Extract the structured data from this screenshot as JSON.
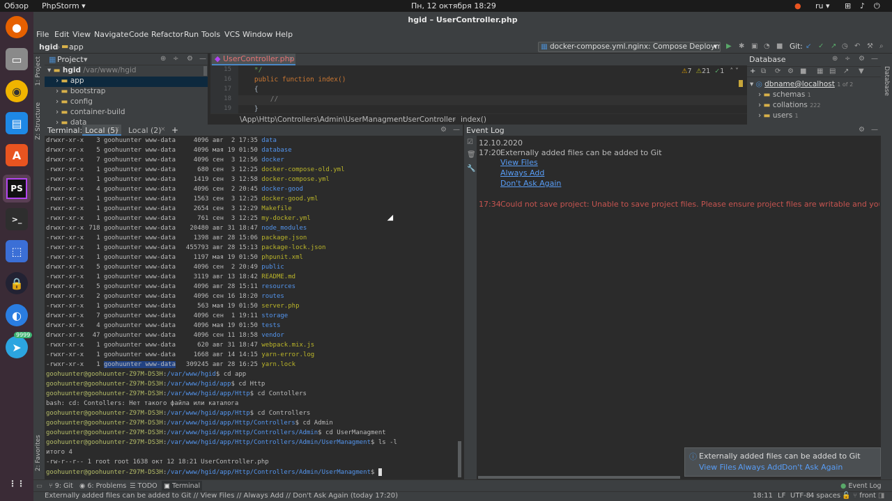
{
  "top_bar": {
    "activities": "Обзор",
    "app_name": "PhpStorm",
    "clock": "Пн, 12 октября  18:29",
    "lang": "ru"
  },
  "dock": {
    "telegram_badge": "9999",
    "phpstorm_label": "PS",
    "software_label": "A"
  },
  "window_title": "hgid – UserController.php",
  "menu": [
    "File",
    "Edit",
    "View",
    "Navigate",
    "Code",
    "Refactor",
    "Run",
    "Tools",
    "VCS",
    "Window",
    "Help"
  ],
  "nav": {
    "crumb1": "hgid",
    "crumb2": "app",
    "run_config": "docker-compose.yml.nginx: Compose Deployment",
    "git_label": "Git:"
  },
  "left_strip": {
    "project": "1: Project",
    "structure": "Z: Structure",
    "favorites": "2: Favorites"
  },
  "right_strip": {
    "database": "Database"
  },
  "project_panel": {
    "header": "Project",
    "root_name": "hgid",
    "root_path": "/var/www/hgid",
    "items": [
      "app",
      "bootstrap",
      "config",
      "container-build",
      "data"
    ]
  },
  "editor": {
    "tab": "UserController.php",
    "inspections": {
      "warnings": "7",
      "weak": "21",
      "typos": "1"
    },
    "lines": [
      {
        "n": "15",
        "code": "    */"
      },
      {
        "n": "16",
        "code": "    public function index()"
      },
      {
        "n": "17",
        "code": "    {"
      },
      {
        "n": "18",
        "code": "        //"
      },
      {
        "n": "19",
        "code": "    }"
      }
    ],
    "breadcrumb": [
      "\\App\\Http\\Controllers\\Admin\\UserManagment",
      "UserController",
      "index()"
    ]
  },
  "database": {
    "header": "Database",
    "connection": "dbname@localhost",
    "connection_badge": "1 of 2",
    "nodes": [
      {
        "label": "schemas",
        "count": "1"
      },
      {
        "label": "collations",
        "count": "222"
      },
      {
        "label": "users",
        "count": "1"
      }
    ]
  },
  "terminal": {
    "label": "Terminal:",
    "tabs": [
      "Local (5)",
      "Local (2)"
    ],
    "listing": [
      {
        "perm": "drwxr-xr-x",
        "links": "3",
        "user": "goohuunter",
        "group": "www-data",
        "size": "4096",
        "date": "авг  2 17:35",
        "name": "data",
        "kind": "dir"
      },
      {
        "perm": "drwxr-xr-x",
        "links": "5",
        "user": "goohuunter",
        "group": "www-data",
        "size": "4096",
        "date": "мая 19 01:50",
        "name": "database",
        "kind": "dir"
      },
      {
        "perm": "drwxr-xr-x",
        "links": "7",
        "user": "goohuunter",
        "group": "www-data",
        "size": "4096",
        "date": "сен  3 12:56",
        "name": "docker",
        "kind": "dir"
      },
      {
        "perm": "-rwxr-xr-x",
        "links": "1",
        "user": "goohuunter",
        "group": "www-data",
        "size": "680",
        "date": "сен  3 12:25",
        "name": "docker-compose-old.yml",
        "kind": "file"
      },
      {
        "perm": "-rwxr-xr-x",
        "links": "1",
        "user": "goohuunter",
        "group": "www-data",
        "size": "1419",
        "date": "сен  3 12:58",
        "name": "docker-compose.yml",
        "kind": "file"
      },
      {
        "perm": "drwxr-xr-x",
        "links": "4",
        "user": "goohuunter",
        "group": "www-data",
        "size": "4096",
        "date": "сен  2 20:45",
        "name": "docker-good",
        "kind": "dir"
      },
      {
        "perm": "-rwxr-xr-x",
        "links": "1",
        "user": "goohuunter",
        "group": "www-data",
        "size": "1563",
        "date": "сен  3 12:25",
        "name": "docker-good.yml",
        "kind": "file"
      },
      {
        "perm": "-rwxr-xr-x",
        "links": "1",
        "user": "goohuunter",
        "group": "www-data",
        "size": "2654",
        "date": "сен  3 12:29",
        "name": "Makefile",
        "kind": "file"
      },
      {
        "perm": "-rwxr-xr-x",
        "links": "1",
        "user": "goohuunter",
        "group": "www-data",
        "size": "761",
        "date": "сен  3 12:25",
        "name": "my-docker.yml",
        "kind": "file"
      },
      {
        "perm": "drwxr-xr-x",
        "links": "718",
        "user": "goohuunter",
        "group": "www-data",
        "size": "20480",
        "date": "авг 31 18:47",
        "name": "node_modules",
        "kind": "dir"
      },
      {
        "perm": "-rwxr-xr-x",
        "links": "1",
        "user": "goohuunter",
        "group": "www-data",
        "size": "1398",
        "date": "авг 28 15:06",
        "name": "package.json",
        "kind": "file"
      },
      {
        "perm": "-rwxr-xr-x",
        "links": "1",
        "user": "goohuunter",
        "group": "www-data",
        "size": "455793",
        "date": "авг 28 15:13",
        "name": "package-lock.json",
        "kind": "file"
      },
      {
        "perm": "-rwxr-xr-x",
        "links": "1",
        "user": "goohuunter",
        "group": "www-data",
        "size": "1197",
        "date": "мая 19 01:50",
        "name": "phpunit.xml",
        "kind": "file"
      },
      {
        "perm": "drwxr-xr-x",
        "links": "5",
        "user": "goohuunter",
        "group": "www-data",
        "size": "4096",
        "date": "сен  2 20:49",
        "name": "public",
        "kind": "dir"
      },
      {
        "perm": "-rwxr-xr-x",
        "links": "1",
        "user": "goohuunter",
        "group": "www-data",
        "size": "3119",
        "date": "авг 13 18:42",
        "name": "README.md",
        "kind": "file"
      },
      {
        "perm": "drwxr-xr-x",
        "links": "5",
        "user": "goohuunter",
        "group": "www-data",
        "size": "4096",
        "date": "авг 28 15:11",
        "name": "resources",
        "kind": "dir"
      },
      {
        "perm": "drwxr-xr-x",
        "links": "2",
        "user": "goohuunter",
        "group": "www-data",
        "size": "4096",
        "date": "сен 16 18:20",
        "name": "routes",
        "kind": "dir"
      },
      {
        "perm": "-rwxr-xr-x",
        "links": "1",
        "user": "goohuunter",
        "group": "www-data",
        "size": "563",
        "date": "мая 19 01:50",
        "name": "server.php",
        "kind": "file"
      },
      {
        "perm": "drwxr-xr-x",
        "links": "7",
        "user": "goohuunter",
        "group": "www-data",
        "size": "4096",
        "date": "сен  1 19:11",
        "name": "storage",
        "kind": "dir"
      },
      {
        "perm": "drwxr-xr-x",
        "links": "4",
        "user": "goohuunter",
        "group": "www-data",
        "size": "4096",
        "date": "мая 19 01:50",
        "name": "tests",
        "kind": "dir"
      },
      {
        "perm": "drwxr-xr-x",
        "links": "47",
        "user": "goohuunter",
        "group": "www-data",
        "size": "4096",
        "date": "сен 11 18:58",
        "name": "vendor",
        "kind": "dir"
      },
      {
        "perm": "-rwxr-xr-x",
        "links": "1",
        "user": "goohuunter",
        "group": "www-data",
        "size": "620",
        "date": "авг 31 18:47",
        "name": "webpack.mix.js",
        "kind": "file"
      },
      {
        "perm": "-rwxr-xr-x",
        "links": "1",
        "user": "goohuunter",
        "group": "www-data",
        "size": "1668",
        "date": "авг 14 14:15",
        "name": "yarn-error.log",
        "kind": "file"
      },
      {
        "perm": "-rwxr-xr-x",
        "links": "1",
        "user": "goohuunter",
        "group": "www-data",
        "size": "309245",
        "date": "авг 28 16:25",
        "name": "yarn.lock",
        "kind": "file"
      }
    ],
    "session": [
      {
        "type": "prompt",
        "user": "goohuunter@goohuunter-Z97M-DS3H",
        "path": "/var/www/hgid",
        "cmd": " cd app"
      },
      {
        "type": "prompt",
        "user": "goohuunter@goohuunter-Z97M-DS3H",
        "path": "/var/www/hgid/app",
        "cmd": " cd Http"
      },
      {
        "type": "prompt",
        "user": "goohuunter@goohuunter-Z97M-DS3H",
        "path": "/var/www/hgid/app/Http",
        "cmd": " cd Contollers"
      },
      {
        "type": "out",
        "text": "bash: cd: Contollers: Нет такого файла или каталога"
      },
      {
        "type": "prompt",
        "user": "goohuunter@goohuunter-Z97M-DS3H",
        "path": "/var/www/hgid/app/Http",
        "cmd": " cd Controllers"
      },
      {
        "type": "prompt",
        "user": "goohuunter@goohuunter-Z97M-DS3H",
        "path": "/var/www/hgid/app/Http/Controllers",
        "cmd": " cd Admin"
      },
      {
        "type": "prompt",
        "user": "goohuunter@goohuunter-Z97M-DS3H",
        "path": "/var/www/hgid/app/Http/Controllers/Admin",
        "cmd": " cd UserManagment"
      },
      {
        "type": "prompt",
        "user": "goohuunter@goohuunter-Z97M-DS3H",
        "path": "/var/www/hgid/app/Http/Controllers/Admin/UserManagment",
        "cmd": " ls -l"
      },
      {
        "type": "out",
        "text": "итого 4"
      },
      {
        "type": "out",
        "text": "-rw-r--r-- 1 root root 1638 окт 12 18:21 UserController.php"
      },
      {
        "type": "prompt",
        "user": "goohuunter@goohuunter-Z97M-DS3H",
        "path": "/var/www/hgid/app/Http/Controllers/Admin/UserManagment",
        "cmd": " "
      }
    ]
  },
  "event_log": {
    "header": "Event Log",
    "date": "12.10.2020",
    "entry1_time": "17:20",
    "entry1_text": "Externally added files can be added to Git",
    "entry1_links": [
      "View Files",
      "Always Add",
      "Don't Ask Again"
    ],
    "entry2_time": "17:34",
    "entry2_text": "Could not save project: Unable to save project files. Please ensure project files are writable and you have permissions to m"
  },
  "notification": {
    "text": "Externally added files can be added to Git",
    "links": [
      "View Files",
      "Always Add",
      "Don't Ask Again"
    ]
  },
  "tool_windows": [
    "9: Git",
    "6: Problems",
    "TODO",
    "Terminal"
  ],
  "event_log_button": "Event Log",
  "status": {
    "message": "Externally added files can be added to Git // View Files // Always Add // Don't Ask Again (today 17:20)",
    "position": "18:11",
    "line_sep": "LF",
    "encoding": "UTF-8",
    "indent": "4 spaces",
    "branch": "front"
  },
  "colors": {
    "accent": "#4a88c7",
    "dir": "#5394ec",
    "file": "#bbb529",
    "prompt": "#b5bd68",
    "error": "#c75450"
  }
}
